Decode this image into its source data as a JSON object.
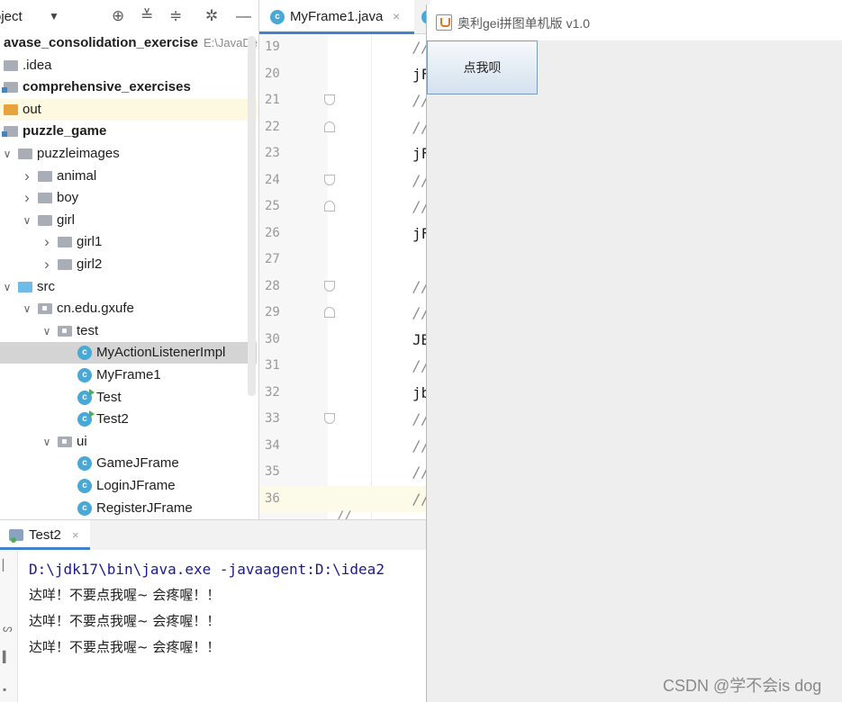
{
  "project_panel": {
    "title": "oject",
    "dropdown": "▼",
    "toolbar_icons": [
      "crosshair-icon",
      "expand-all-icon",
      "collapse-all-icon",
      "gear-icon",
      "minimize-icon"
    ],
    "tree": [
      {
        "label": "avase_consolidation_exercise",
        "path": "E:\\JavaDe",
        "bold": true,
        "indent": 0,
        "icon": "module"
      },
      {
        "label": ".idea",
        "indent": 0,
        "icon": "folder"
      },
      {
        "label": "comprehensive_exercises",
        "bold": true,
        "indent": 0,
        "icon": "module"
      },
      {
        "label": "out",
        "indent": 0,
        "icon": "folder-orange",
        "excluded": true
      },
      {
        "label": "puzzle_game",
        "bold": true,
        "indent": 0,
        "icon": "module"
      },
      {
        "label": "puzzleimages",
        "indent": 1,
        "icon": "folder",
        "arrow": "open"
      },
      {
        "label": "animal",
        "indent": 2,
        "icon": "folder",
        "arrow": "closed"
      },
      {
        "label": "boy",
        "indent": 2,
        "icon": "folder",
        "arrow": "closed"
      },
      {
        "label": "girl",
        "indent": 2,
        "icon": "folder",
        "arrow": "open"
      },
      {
        "label": "girl1",
        "indent": 3,
        "icon": "folder",
        "arrow": "closed"
      },
      {
        "label": "girl2",
        "indent": 3,
        "icon": "folder",
        "arrow": "closed"
      },
      {
        "label": "src",
        "indent": 1,
        "icon": "folder-blue",
        "arrow": "open"
      },
      {
        "label": "cn.edu.gxufe",
        "indent": 2,
        "icon": "package",
        "arrow": "open"
      },
      {
        "label": "test",
        "indent": 3,
        "icon": "package",
        "arrow": "open"
      },
      {
        "label": "MyActionListenerImpl",
        "indent": 4,
        "icon": "class",
        "selected": true
      },
      {
        "label": "MyFrame1",
        "indent": 4,
        "icon": "class"
      },
      {
        "label": "Test",
        "indent": 4,
        "icon": "class-runnable"
      },
      {
        "label": "Test2",
        "indent": 4,
        "icon": "class-runnable"
      },
      {
        "label": "ui",
        "indent": 3,
        "icon": "package",
        "arrow": "open"
      },
      {
        "label": "GameJFrame",
        "indent": 4,
        "icon": "class"
      },
      {
        "label": "LoginJFrame",
        "indent": 4,
        "icon": "class"
      },
      {
        "label": "RegisterJFrame",
        "indent": 4,
        "icon": "class"
      }
    ]
  },
  "editor": {
    "tab_label": "MyFrame1.java",
    "tab_close": "×",
    "class_icon_letter": "c",
    "lines": [
      {
        "num": "19",
        "code": "//",
        "comment": true
      },
      {
        "num": "20",
        "code": "jF"
      },
      {
        "num": "21",
        "code": "//",
        "comment": true,
        "fold": "close"
      },
      {
        "num": "22",
        "code": "//",
        "comment": true,
        "fold": "open"
      },
      {
        "num": "23",
        "code": "jF"
      },
      {
        "num": "24",
        "code": "//",
        "comment": true,
        "fold": "close"
      },
      {
        "num": "25",
        "code": "//",
        "comment": true,
        "fold": "open"
      },
      {
        "num": "26",
        "code": "jF"
      },
      {
        "num": "27",
        "code": ""
      },
      {
        "num": "28",
        "code": "//",
        "comment": true,
        "fold": "close"
      },
      {
        "num": "29",
        "code": "//",
        "comment": true,
        "fold": "open"
      },
      {
        "num": "30",
        "code": "JB"
      },
      {
        "num": "31",
        "code": "//",
        "comment": true
      },
      {
        "num": "32",
        "code": "jb"
      },
      {
        "num": "33",
        "code": "//",
        "comment": true,
        "fold": "close"
      },
      {
        "num": "34",
        "code": "//",
        "comment": true
      },
      {
        "num": "35",
        "code": "//",
        "comment": true
      },
      {
        "num": "36",
        "code": "//",
        "comment": true,
        "current": true
      }
    ],
    "partial_line": "//"
  },
  "run_panel": {
    "tab_label": "Test2",
    "tab_close": "×",
    "console": [
      {
        "text": "D:\\jdk17\\bin\\java.exe -javaagent:D:\\idea2",
        "kind": "command"
      },
      {
        "text": "达咩！不要点我喔~ 会疼喔！！",
        "kind": "output"
      },
      {
        "text": "达咩！不要点我喔~ 会疼喔！！",
        "kind": "output"
      },
      {
        "text": "达咩！不要点我喔~ 会疼喔！！",
        "kind": "output"
      }
    ]
  },
  "game_window": {
    "title": "奥利gei拼图单机版 v1.0",
    "button_label": "点我呗"
  },
  "watermark": "CSDN @学不会is dog",
  "colors": {
    "accent": "#4083c9",
    "selection": "#d4d4d4",
    "class_icon": "#48a8d6",
    "console_command": "#1a1a8c"
  }
}
